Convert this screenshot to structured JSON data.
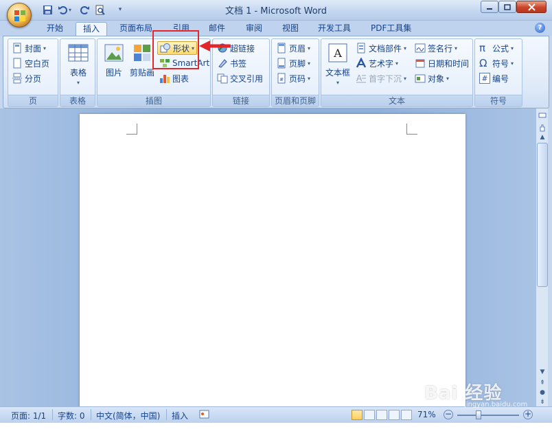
{
  "window": {
    "title": "文档 1 - Microsoft Word"
  },
  "tabs": [
    {
      "label": "开始"
    },
    {
      "label": "插入",
      "active": true
    },
    {
      "label": "页面布局"
    },
    {
      "label": "引用"
    },
    {
      "label": "邮件"
    },
    {
      "label": "审阅"
    },
    {
      "label": "视图"
    },
    {
      "label": "开发工具"
    },
    {
      "label": "PDF工具集"
    }
  ],
  "ribbon": {
    "page_group": {
      "label": "页",
      "items": [
        "封面",
        "空白页",
        "分页"
      ]
    },
    "table_group": {
      "label": "表格",
      "table_button": "表格"
    },
    "illustrations_group": {
      "label": "插图",
      "picture": "图片",
      "clipart": "剪贴画",
      "shapes": "形状",
      "smartart": "SmartArt",
      "chart": "图表"
    },
    "links_group": {
      "label": "链接",
      "items": [
        "超链接",
        "书签",
        "交叉引用"
      ]
    },
    "header_footer_group": {
      "label": "页眉和页脚",
      "items": [
        "页眉",
        "页脚",
        "页码"
      ]
    },
    "text_group": {
      "label": "文本",
      "textbox": "文本框",
      "col1": [
        "文档部件",
        "艺术字",
        "首字下沉"
      ],
      "col2": [
        "签名行",
        "日期和时间",
        "对象"
      ]
    },
    "symbols_group": {
      "label": "符号",
      "items": [
        "公式",
        "符号",
        "编号"
      ]
    }
  },
  "statusbar": {
    "page": "页面: 1/1",
    "words": "字数: 0",
    "language": "中文(简体，中国)",
    "mode": "插入",
    "zoom": "71%"
  },
  "zoom_level": 0.71,
  "watermark": {
    "brand": "Bai 经验",
    "url": "jingyan.baidu.com"
  },
  "colors": {
    "highlight": "#e3262a",
    "ribbon_text": "#15428b"
  }
}
